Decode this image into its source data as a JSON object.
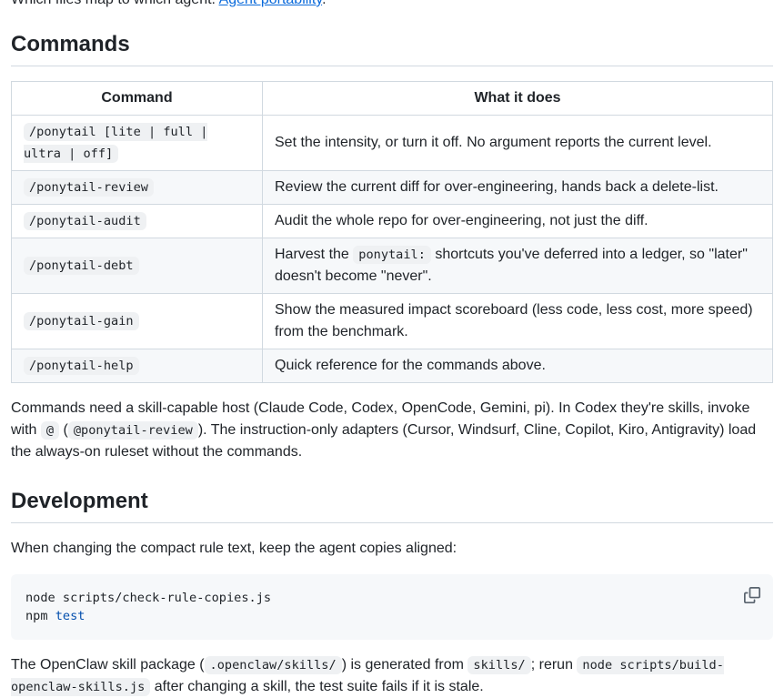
{
  "intro": {
    "text": "Which files map to which agent: ",
    "link": "Agent portability",
    "end": "."
  },
  "commands": {
    "heading": "Commands",
    "headers": [
      "Command",
      "What it does"
    ],
    "rows": [
      {
        "command": "/ponytail [lite | full | ultra | off]",
        "desc": "Set the intensity, or turn it off. No argument reports the current level."
      },
      {
        "command": "/ponytail-review",
        "desc": "Review the current diff for over-engineering, hands back a delete-list."
      },
      {
        "command": "/ponytail-audit",
        "desc": "Audit the whole repo for over-engineering, not just the diff."
      },
      {
        "command": "/ponytail-debt",
        "desc_a": "Harvest the ",
        "desc_code": "ponytail:",
        "desc_b": " shortcuts you've deferred into a ledger, so \"later\" doesn't become \"never\"."
      },
      {
        "command": "/ponytail-gain",
        "desc": "Show the measured impact scoreboard (less code, less cost, more speed) from the benchmark."
      },
      {
        "command": "/ponytail-help",
        "desc": "Quick reference for the commands above."
      }
    ],
    "note": {
      "a": "Commands need a skill-capable host (Claude Code, Codex, OpenCode, Gemini, pi). In Codex they're skills, invoke with ",
      "code1": "@",
      "b": " (",
      "code2": "@ponytail-review",
      "c": "). The instruction-only adapters (Cursor, Windsurf, Cline, Copilot, Kiro, Antigravity) load the always-on ruleset without the commands."
    }
  },
  "development": {
    "heading": "Development",
    "intro": "When changing the compact rule text, keep the agent copies aligned:",
    "code_lines": {
      "line1": "node scripts/check-rule-copies.js",
      "line2_cmd": "npm ",
      "line2_arg": "test"
    },
    "copy_icon": "copy-icon",
    "outro": {
      "a": "The OpenClaw skill package (",
      "code1": ".openclaw/skills/",
      "b": ") is generated from ",
      "code2": "skills/",
      "c": "; rerun ",
      "code3": "node scripts/build-openclaw-skills.js",
      "d": " after changing a skill, the test suite fails if it is stale."
    }
  }
}
